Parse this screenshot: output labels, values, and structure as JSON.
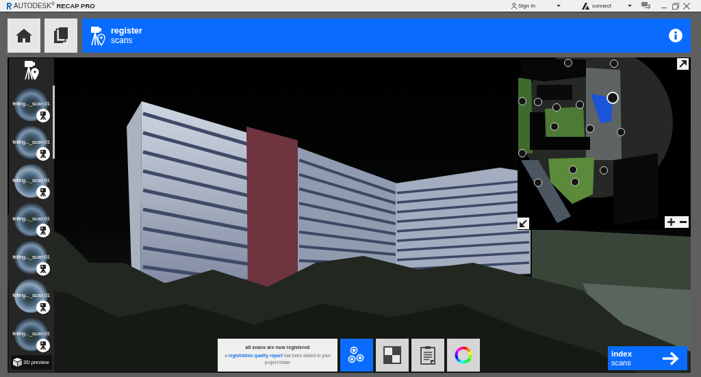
{
  "title_bar": {
    "brand": "AUTODESK$^{®}$",
    "product": "RECAP PRO",
    "sign_in": "Sign In",
    "connect": "connect"
  },
  "header": {
    "title": "register",
    "subtitle": "scans"
  },
  "scans": [
    {
      "label": "felling..._scan 01"
    },
    {
      "label": "felling..._scan 01"
    },
    {
      "label": "felling..._scan 01"
    },
    {
      "label": "felling..._scan 01"
    },
    {
      "label": "felling..._scan 01"
    },
    {
      "label": "felling..._scan 01"
    },
    {
      "label": "felling..._scan 01"
    }
  ],
  "preview_button": {
    "label": "3D preview"
  },
  "minimap": {
    "markers": [
      {
        "selected": false
      },
      {
        "selected": false
      },
      {
        "selected": false
      },
      {
        "selected": false
      },
      {
        "selected": false
      },
      {
        "selected": false
      },
      {
        "selected": true
      },
      {
        "selected": false
      },
      {
        "selected": false
      },
      {
        "selected": false
      },
      {
        "selected": false
      },
      {
        "selected": false
      },
      {
        "selected": false
      },
      {
        "selected": false
      },
      {
        "selected": false
      }
    ]
  },
  "notification": {
    "title": "all scans are now registered",
    "message_start": "a",
    "link": "registration quality report",
    "message_end": "has been added to your project folder"
  },
  "tools": [
    {
      "kind": "registration",
      "selected": true
    },
    {
      "kind": "checker",
      "selected": false
    },
    {
      "kind": "report",
      "selected": false
    },
    {
      "kind": "color",
      "selected": false
    }
  ],
  "next_button": {
    "title": "index",
    "subtitle": "scans"
  }
}
